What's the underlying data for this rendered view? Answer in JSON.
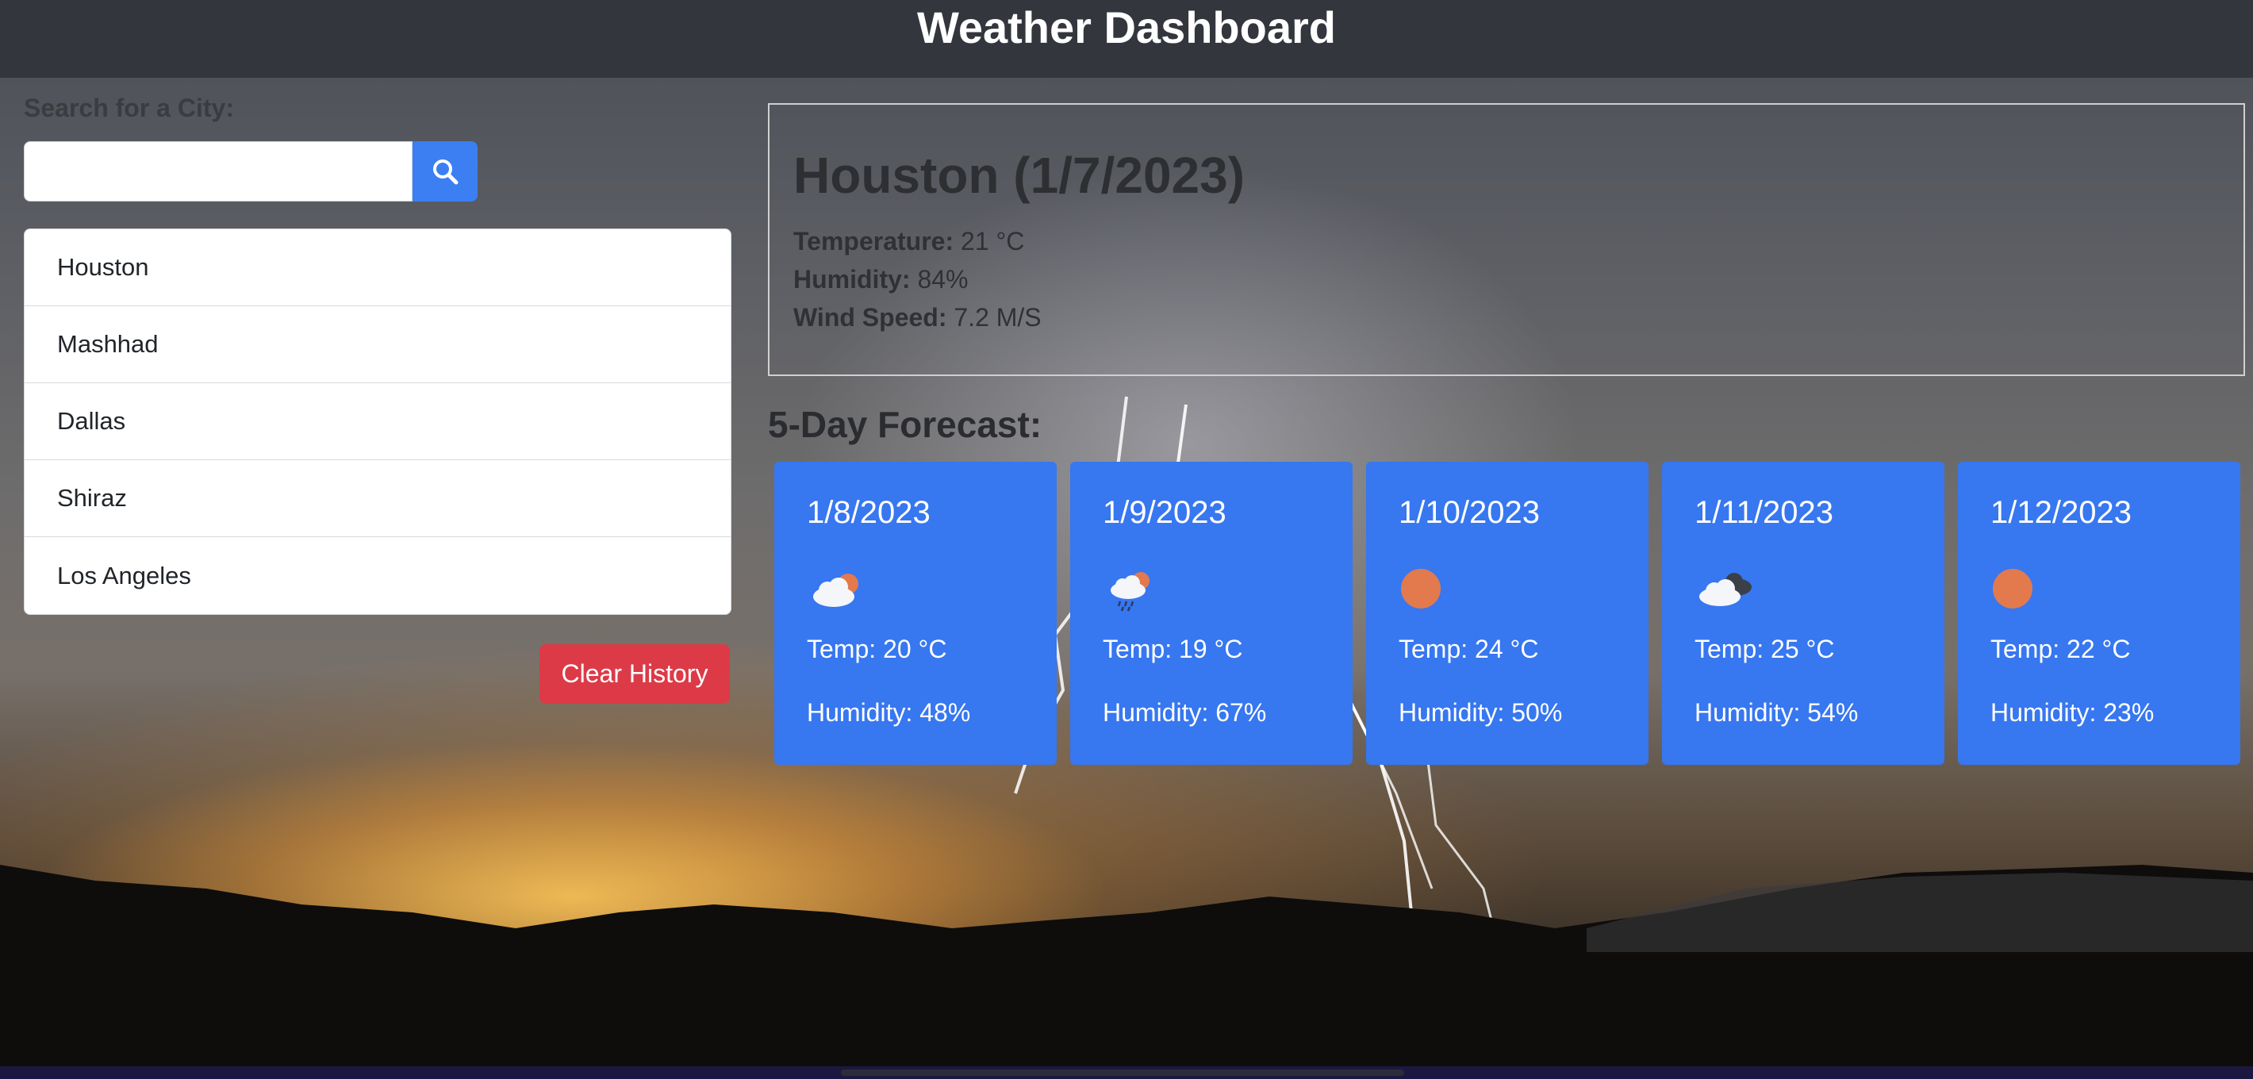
{
  "header": {
    "title": "Weather Dashboard"
  },
  "search": {
    "label": "Search for a City:",
    "placeholder": "",
    "value": ""
  },
  "history": {
    "items": [
      "Houston",
      "Mashhad",
      "Dallas",
      "Shiraz",
      "Los Angeles"
    ],
    "clear_label": "Clear History"
  },
  "current": {
    "title": "Houston (1/7/2023)",
    "temperature_label": "Temperature:",
    "temperature_value": "21 °C",
    "humidity_label": "Humidity:",
    "humidity_value": "84%",
    "wind_label": "Wind Speed:",
    "wind_value": "7.2 M/S",
    "icon": "mist-icon"
  },
  "forecast": {
    "title": "5-Day Forecast:",
    "days": [
      {
        "date": "1/8/2023",
        "icon": "partly-cloudy-icon",
        "temp": "Temp: 20 °C",
        "humidity": "Humidity: 48%"
      },
      {
        "date": "1/9/2023",
        "icon": "rain-sun-icon",
        "temp": "Temp: 19 °C",
        "humidity": "Humidity: 67%"
      },
      {
        "date": "1/10/2023",
        "icon": "sun-icon",
        "temp": "Temp: 24 °C",
        "humidity": "Humidity: 50%"
      },
      {
        "date": "1/11/2023",
        "icon": "broken-clouds-icon",
        "temp": "Temp: 25 °C",
        "humidity": "Humidity: 54%"
      },
      {
        "date": "1/12/2023",
        "icon": "sun-icon",
        "temp": "Temp: 22 °C",
        "humidity": "Humidity: 23%"
      }
    ]
  },
  "colors": {
    "header_bg": "#33373d",
    "card_bg": "#3777f0",
    "search_button": "#3b7ff2",
    "clear_button": "#dc3a47"
  }
}
